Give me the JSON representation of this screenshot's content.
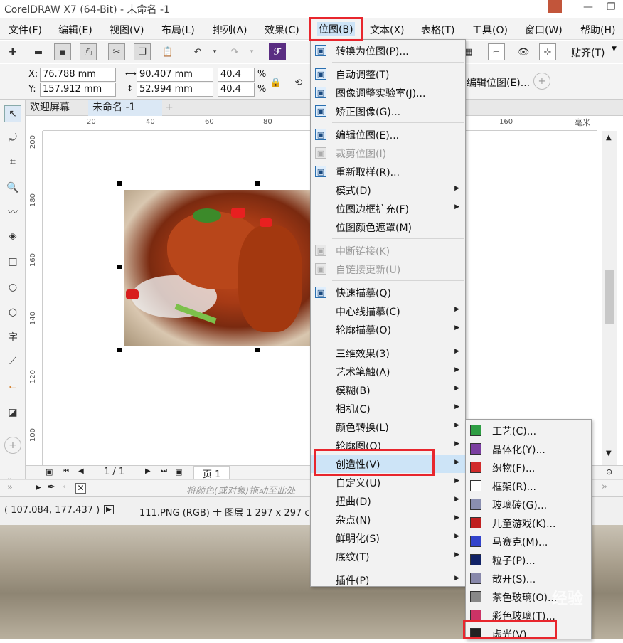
{
  "window": {
    "title": "CorelDRAW X7 (64-Bit) - 未命名 -1",
    "minimize": "—",
    "restore": "❐"
  },
  "menubar": [
    "文件(F)",
    "编辑(E)",
    "视图(V)",
    "布局(L)",
    "排列(A)",
    "效果(C)",
    "位图(B)",
    "文本(X)",
    "表格(T)",
    "工具(O)",
    "窗口(W)",
    "帮助(H)"
  ],
  "toolbar": {
    "snap_label": "贴齐(T)",
    "convert_bitmap_label": "编辑位图(E)..."
  },
  "properties": {
    "x_label": "X:",
    "x": "76.788 mm",
    "y_label": "Y:",
    "y": "157.912 mm",
    "w": "90.407 mm",
    "h": "52.994 mm",
    "scale_x": "40.4",
    "scale_y": "40.4",
    "percent": "%"
  },
  "doc_tabs": [
    "欢迎屏幕",
    "未命名 -1"
  ],
  "rulers": {
    "unit": "毫米",
    "h_ticks": [
      "20",
      "40",
      "60",
      "80",
      "160"
    ],
    "v_ticks": [
      "200",
      "180",
      "160",
      "140",
      "120",
      "100"
    ]
  },
  "pagebar": {
    "page_count": "1 / 1",
    "page_tab": "页 1"
  },
  "palette_hint": "将颜色(或对象)拖动至此处",
  "status": {
    "coords": "( 107.084, 177.437 )",
    "info": "111.PNG (RGB) 于 图层 1 297 x 297 c"
  },
  "bitmap_menu": {
    "items": [
      {
        "label": "转换为位图(P)...",
        "icon": "convert-bitmap-icon",
        "disabled": false,
        "sub": false
      },
      {
        "sep": true
      },
      {
        "label": "自动调整(T)",
        "icon": "auto-adjust-icon",
        "disabled": false,
        "sub": false
      },
      {
        "label": "图像调整实验室(J)...",
        "icon": "image-lab-icon",
        "disabled": false,
        "sub": false
      },
      {
        "label": "矫正图像(G)...",
        "icon": "straighten-icon",
        "disabled": false,
        "sub": false
      },
      {
        "sep": true
      },
      {
        "label": "编辑位图(E)...",
        "icon": "edit-bitmap-icon",
        "disabled": false,
        "sub": false
      },
      {
        "label": "裁剪位图(I)",
        "icon": "crop-bitmap-icon",
        "disabled": true,
        "sub": false
      },
      {
        "label": "重新取样(R)...",
        "icon": "resample-icon",
        "disabled": false,
        "sub": false
      },
      {
        "label": "模式(D)",
        "icon": "",
        "disabled": false,
        "sub": true
      },
      {
        "label": "位图边框扩充(F)",
        "icon": "",
        "disabled": false,
        "sub": true
      },
      {
        "label": "位图颜色遮罩(M)",
        "icon": "",
        "disabled": false,
        "sub": false
      },
      {
        "sep": true
      },
      {
        "label": "中断链接(K)",
        "icon": "break-link-icon",
        "disabled": true,
        "sub": false
      },
      {
        "label": "自链接更新(U)",
        "icon": "update-link-icon",
        "disabled": true,
        "sub": false
      },
      {
        "sep": true
      },
      {
        "label": "快速描摹(Q)",
        "icon": "quick-trace-icon",
        "disabled": false,
        "sub": false
      },
      {
        "label": "中心线描摹(C)",
        "icon": "",
        "disabled": false,
        "sub": true
      },
      {
        "label": "轮廓描摹(O)",
        "icon": "",
        "disabled": false,
        "sub": true
      },
      {
        "sep": true
      },
      {
        "label": "三维效果(3)",
        "icon": "",
        "disabled": false,
        "sub": true
      },
      {
        "label": "艺术笔触(A)",
        "icon": "",
        "disabled": false,
        "sub": true
      },
      {
        "label": "模糊(B)",
        "icon": "",
        "disabled": false,
        "sub": true
      },
      {
        "label": "相机(C)",
        "icon": "",
        "disabled": false,
        "sub": true
      },
      {
        "label": "颜色转换(L)",
        "icon": "",
        "disabled": false,
        "sub": true
      },
      {
        "label": "轮廓图(O)",
        "icon": "",
        "disabled": false,
        "sub": true
      },
      {
        "label": "创造性(V)",
        "icon": "",
        "disabled": false,
        "sub": true,
        "highlight": true
      },
      {
        "label": "自定义(U)",
        "icon": "",
        "disabled": false,
        "sub": true
      },
      {
        "label": "扭曲(D)",
        "icon": "",
        "disabled": false,
        "sub": true
      },
      {
        "label": "杂点(N)",
        "icon": "",
        "disabled": false,
        "sub": true
      },
      {
        "label": "鲜明化(S)",
        "icon": "",
        "disabled": false,
        "sub": true
      },
      {
        "label": "底纹(T)",
        "icon": "",
        "disabled": false,
        "sub": true
      },
      {
        "sep": true
      },
      {
        "label": "插件(P)",
        "icon": "",
        "disabled": false,
        "sub": true
      }
    ]
  },
  "creative_menu": {
    "items": [
      {
        "label": "工艺(C)...",
        "icon": "craft-icon",
        "color": "#2f9e44"
      },
      {
        "label": "晶体化(Y)...",
        "icon": "crystallize-icon",
        "color": "#7b3fa0"
      },
      {
        "label": "织物(F)...",
        "icon": "fabric-icon",
        "color": "#d12b2b"
      },
      {
        "label": "框架(R)...",
        "icon": "frame-icon",
        "color": "#ffffff"
      },
      {
        "label": "玻璃砖(G)...",
        "icon": "glass-block-icon",
        "color": "#8a8fb0"
      },
      {
        "label": "儿童游戏(K)...",
        "icon": "kids-play-icon",
        "color": "#c02020"
      },
      {
        "label": "马赛克(M)...",
        "icon": "mosaic-icon",
        "color": "#3344cc"
      },
      {
        "label": "粒子(P)...",
        "icon": "particles-icon",
        "color": "#112266"
      },
      {
        "label": "散开(S)...",
        "icon": "scatter-icon",
        "color": "#8888aa"
      },
      {
        "label": "茶色玻璃(O)...",
        "icon": "smoked-glass-icon",
        "color": "#888888"
      },
      {
        "label": "彩色玻璃(T)...",
        "icon": "stained-glass-icon",
        "color": "#cc3366"
      },
      {
        "label": "虚光(V)...",
        "icon": "vignette-icon",
        "color": "#222222"
      }
    ]
  },
  "watermark": "经验"
}
